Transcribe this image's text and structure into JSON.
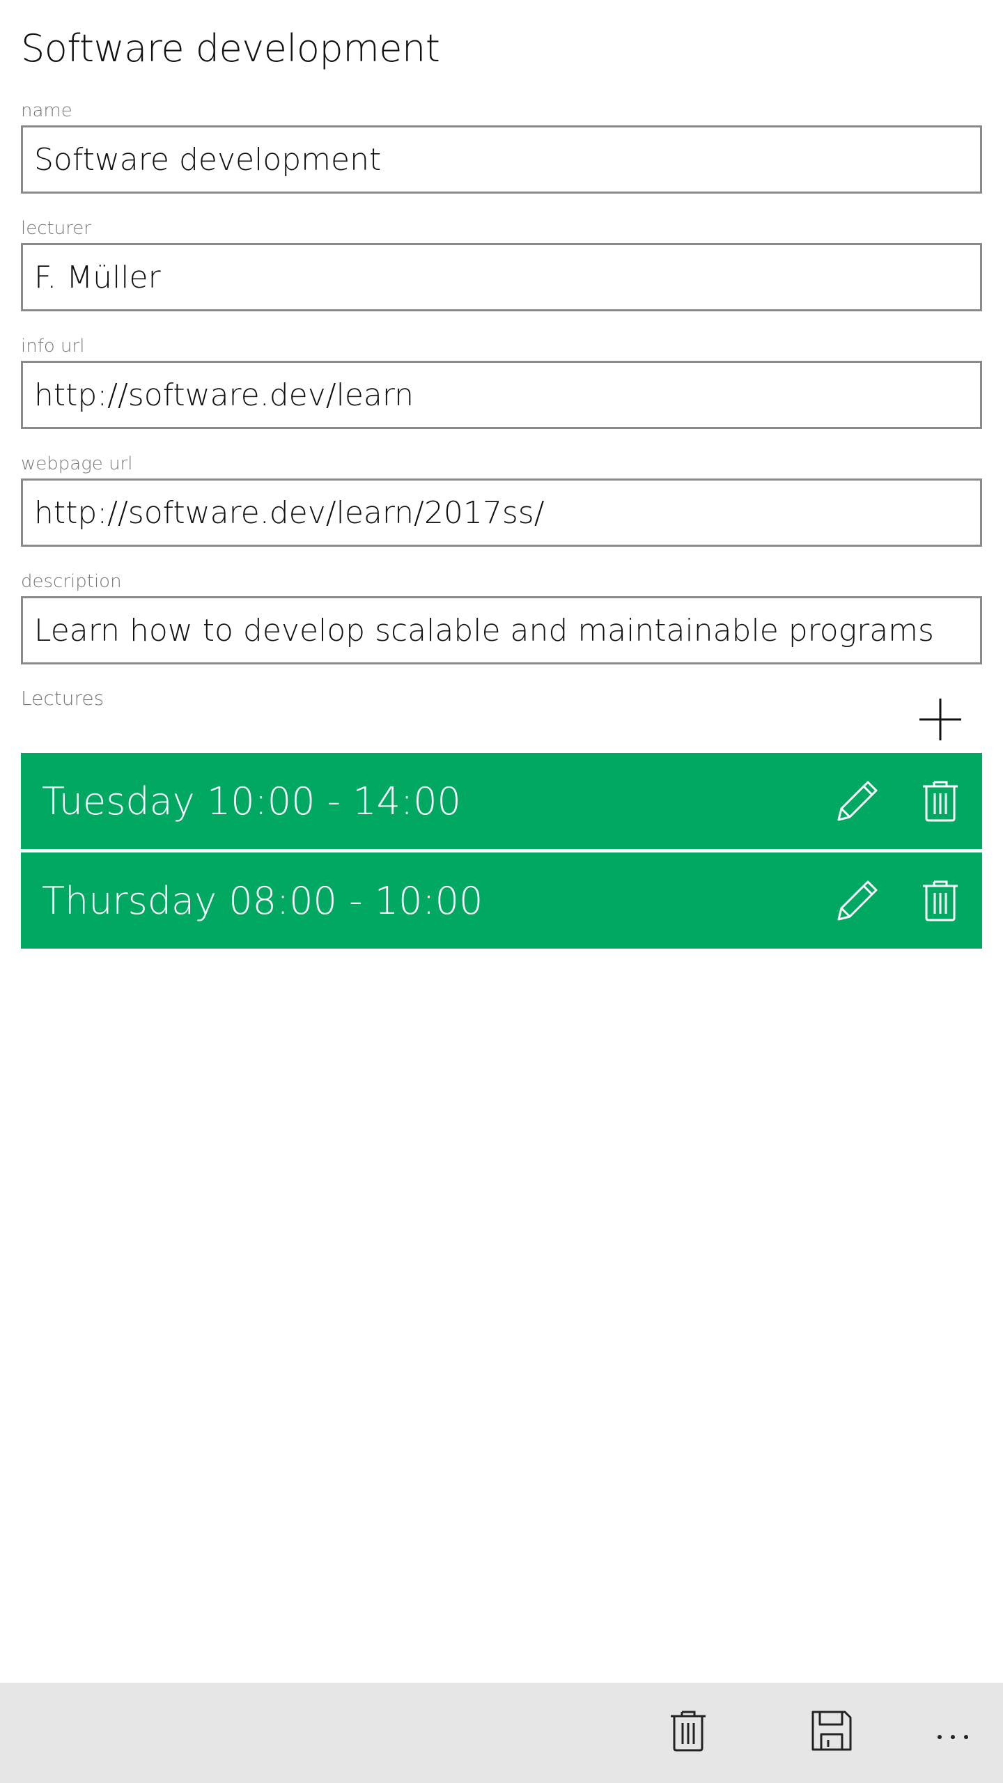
{
  "page": {
    "title": "Software development"
  },
  "form": {
    "name": {
      "label": "name",
      "value": "Software development"
    },
    "lecturer": {
      "label": "lecturer",
      "value": "F. Müller"
    },
    "info_url": {
      "label": "info url",
      "value": "http://software.dev/learn"
    },
    "webpage_url": {
      "label": "webpage url",
      "value": "http://software.dev/learn/2017ss/"
    },
    "description": {
      "label": "description",
      "value": "Learn how to develop scalable and maintainable programs"
    }
  },
  "lectures": {
    "label": "Lectures",
    "items": [
      {
        "label": "Tuesday 10:00 - 14:00"
      },
      {
        "label": "Thursday 08:00 - 10:00"
      }
    ]
  },
  "icons": {
    "add": "plus-icon",
    "edit": "pencil-icon",
    "delete": "trash-icon",
    "save": "floppy-disk-icon",
    "more": "more-ellipsis-icon"
  },
  "colors": {
    "accent": "#00a862",
    "bottom_bar": "#e6e6e6",
    "field_border": "#8a8a8a"
  }
}
